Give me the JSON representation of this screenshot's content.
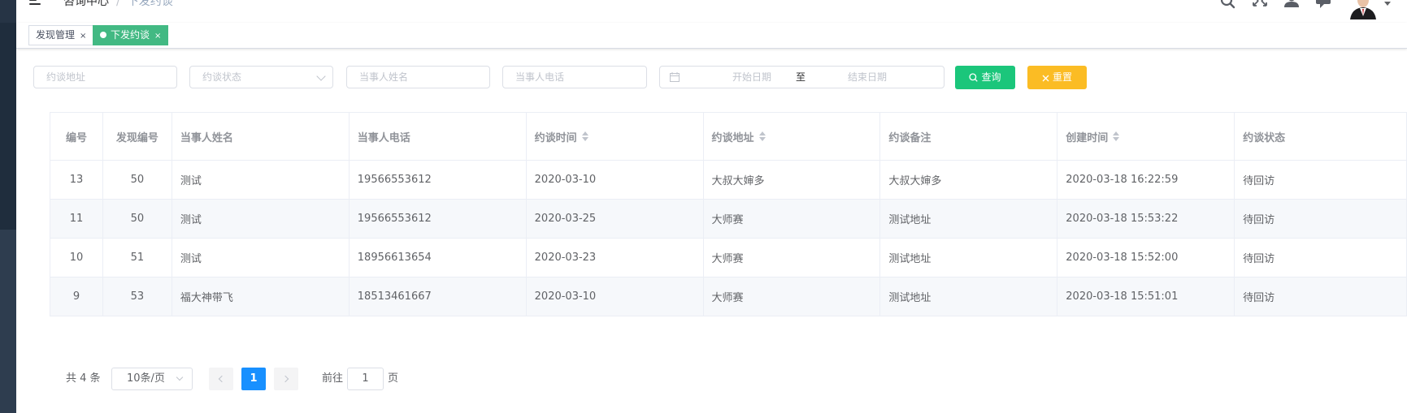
{
  "breadcrumb": {
    "items": [
      "咨询中心",
      "下发约谈"
    ],
    "separator": "/"
  },
  "tags": [
    {
      "label": "发现管理",
      "close": "×",
      "active": false
    },
    {
      "label": "下发约谈",
      "close": "×",
      "active": true
    }
  ],
  "filters": {
    "address_placeholder": "约谈地址",
    "status_placeholder": "约谈状态",
    "name_placeholder": "当事人姓名",
    "phone_placeholder": "当事人电话",
    "start_date_placeholder": "开始日期",
    "range_separator": "至",
    "end_date_placeholder": "结束日期",
    "search_label": "查询",
    "reset_label": "重置"
  },
  "table": {
    "columns": [
      "编号",
      "发现编号",
      "当事人姓名",
      "当事人电话",
      "约谈时间",
      "约谈地址",
      "约谈备注",
      "创建时间",
      "约谈状态"
    ],
    "rows": [
      [
        "13",
        "50",
        "测试",
        "19566553612",
        "2020-03-10",
        "大叔大婶多",
        "大叔大婶多",
        "2020-03-18 16:22:59",
        "待回访"
      ],
      [
        "11",
        "50",
        "测试",
        "19566553612",
        "2020-03-25",
        "大师赛",
        "测试地址",
        "2020-03-18 15:53:22",
        "待回访"
      ],
      [
        "10",
        "51",
        "测试",
        "18956613654",
        "2020-03-23",
        "大师赛",
        "测试地址",
        "2020-03-18 15:52:00",
        "待回访"
      ],
      [
        "9",
        "53",
        "福大神带飞",
        "18513461667",
        "2020-03-10",
        "大师赛",
        "测试地址",
        "2020-03-18 15:51:01",
        "待回访"
      ]
    ]
  },
  "pagination": {
    "total_text": "共 4 条",
    "page_size": "10条/页",
    "current_page": "1",
    "goto_label": "前往",
    "goto_value": "1",
    "goto_suffix": "页"
  },
  "colors": {
    "sidebar": "#2e3d4f",
    "tag_active": "#42b983",
    "search_button": "#1bc67b",
    "reset_button": "#fbbc24",
    "page_active": "#1890ff"
  },
  "icons": [
    "hamburger-icon",
    "search-icon",
    "fullscreen-icon",
    "user-icon",
    "message-icon",
    "calendar-icon",
    "close-icon",
    "sort-icon",
    "chevron-left-icon",
    "chevron-right-icon",
    "chevron-down-icon"
  ]
}
